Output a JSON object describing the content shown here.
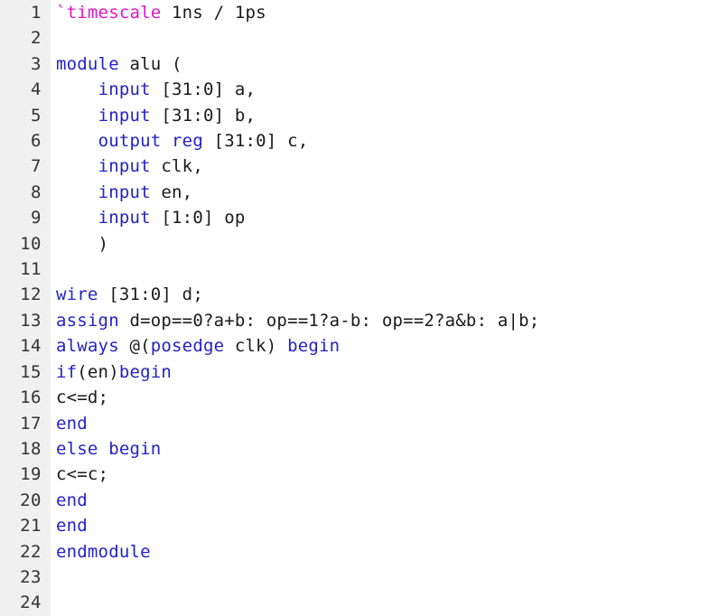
{
  "editor": {
    "language": "verilog",
    "gutter_background": "#f0f0f0",
    "code_background": "#ffffff",
    "keyword_color": "#2222cc",
    "directive_color": "#e214c8",
    "text_color": "#1a1a1a",
    "line_number_color": "#333333",
    "total_lines": 24
  },
  "line_numbers": [
    "1",
    "2",
    "3",
    "4",
    "5",
    "6",
    "7",
    "8",
    "9",
    "10",
    "11",
    "12",
    "13",
    "14",
    "15",
    "16",
    "17",
    "18",
    "19",
    "20",
    "21",
    "22",
    "23",
    "24"
  ],
  "lines": [
    {
      "n": "1",
      "tokens": [
        {
          "t": "dir",
          "s": "`timescale"
        },
        {
          "t": "txt",
          "s": " 1ns / 1ps"
        }
      ]
    },
    {
      "n": "2",
      "tokens": []
    },
    {
      "n": "3",
      "tokens": [
        {
          "t": "kw",
          "s": "module"
        },
        {
          "t": "txt",
          "s": " alu ("
        }
      ]
    },
    {
      "n": "4",
      "tokens": [
        {
          "t": "txt",
          "s": "    "
        },
        {
          "t": "kw",
          "s": "input"
        },
        {
          "t": "txt",
          "s": " [31:0] a,"
        }
      ]
    },
    {
      "n": "5",
      "tokens": [
        {
          "t": "txt",
          "s": "    "
        },
        {
          "t": "kw",
          "s": "input"
        },
        {
          "t": "txt",
          "s": " [31:0] b,"
        }
      ]
    },
    {
      "n": "6",
      "tokens": [
        {
          "t": "txt",
          "s": "    "
        },
        {
          "t": "kw",
          "s": "output reg"
        },
        {
          "t": "txt",
          "s": " [31:0] c,"
        }
      ]
    },
    {
      "n": "7",
      "tokens": [
        {
          "t": "txt",
          "s": "    "
        },
        {
          "t": "kw",
          "s": "input"
        },
        {
          "t": "txt",
          "s": " clk,"
        }
      ]
    },
    {
      "n": "8",
      "tokens": [
        {
          "t": "txt",
          "s": "    "
        },
        {
          "t": "kw",
          "s": "input"
        },
        {
          "t": "txt",
          "s": " en,"
        }
      ]
    },
    {
      "n": "9",
      "tokens": [
        {
          "t": "txt",
          "s": "    "
        },
        {
          "t": "kw",
          "s": "input"
        },
        {
          "t": "txt",
          "s": " [1:0] op"
        }
      ]
    },
    {
      "n": "10",
      "tokens": [
        {
          "t": "txt",
          "s": "    )"
        }
      ]
    },
    {
      "n": "11",
      "tokens": []
    },
    {
      "n": "12",
      "tokens": [
        {
          "t": "kw",
          "s": "wire"
        },
        {
          "t": "txt",
          "s": " [31:0] d;"
        }
      ]
    },
    {
      "n": "13",
      "tokens": [
        {
          "t": "kw",
          "s": "assign"
        },
        {
          "t": "txt",
          "s": " d=op==0?a+b: op==1?a-b: op==2?a&b: a|b;"
        }
      ]
    },
    {
      "n": "14",
      "tokens": [
        {
          "t": "kw",
          "s": "always"
        },
        {
          "t": "txt",
          "s": " @("
        },
        {
          "t": "kw",
          "s": "posedge"
        },
        {
          "t": "txt",
          "s": " clk) "
        },
        {
          "t": "kw",
          "s": "begin"
        }
      ]
    },
    {
      "n": "15",
      "tokens": [
        {
          "t": "kw",
          "s": "if"
        },
        {
          "t": "txt",
          "s": "(en)"
        },
        {
          "t": "kw",
          "s": "begin"
        }
      ]
    },
    {
      "n": "16",
      "tokens": [
        {
          "t": "txt",
          "s": "c<=d;"
        }
      ]
    },
    {
      "n": "17",
      "tokens": [
        {
          "t": "kw",
          "s": "end"
        }
      ]
    },
    {
      "n": "18",
      "tokens": [
        {
          "t": "kw",
          "s": "else begin"
        }
      ]
    },
    {
      "n": "19",
      "tokens": [
        {
          "t": "txt",
          "s": "c<=c;"
        }
      ]
    },
    {
      "n": "20",
      "tokens": [
        {
          "t": "kw",
          "s": "end"
        }
      ]
    },
    {
      "n": "21",
      "tokens": [
        {
          "t": "kw",
          "s": "end"
        }
      ]
    },
    {
      "n": "22",
      "tokens": [
        {
          "t": "kw",
          "s": "endmodule"
        }
      ]
    },
    {
      "n": "23",
      "tokens": []
    },
    {
      "n": "24",
      "tokens": []
    }
  ],
  "plain_text": "`timescale 1ns / 1ps\n\nmodule alu (\n    input [31:0] a,\n    input [31:0] b,\n    output reg [31:0] c,\n    input clk,\n    input en,\n    input [1:0] op\n    )\n\nwire [31:0] d;\nassign d=op==0?a+b: op==1?a-b: op==2?a&b: a|b;\nalways @(posedge clk) begin\nif(en)begin\nc<=d;\nend\nelse begin\nc<=c;\nend\nend\nendmodule\n\n"
}
